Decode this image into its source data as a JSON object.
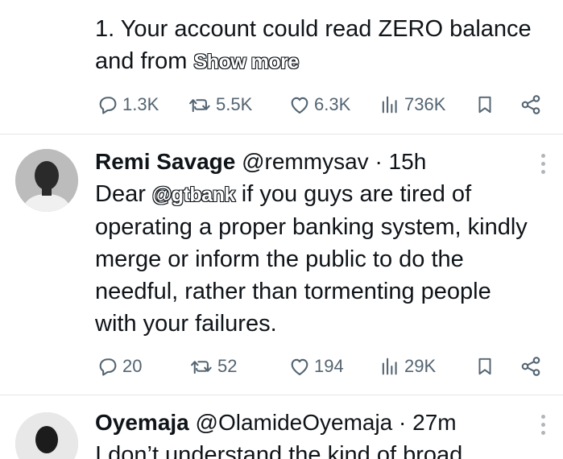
{
  "tweet1": {
    "text_line1": "1. Your account could read ZERO balance",
    "text_line2_prefix": "and from ",
    "show_more": "Show more",
    "replies": "1.3K",
    "retweets": "5.5K",
    "likes": "6.3K",
    "views": "736K"
  },
  "tweet2": {
    "name": "Remi Savage",
    "handle": "@remmysav",
    "separator": "·",
    "time": "15h",
    "text_prefix": "Dear ",
    "mention": "@gtbank",
    "text_rest": " if you guys are tired of operating a proper banking system, kindly merge or inform the public to do the needful, rather than tormenting people with your failures.",
    "replies": "20",
    "retweets": "52",
    "likes": "194",
    "views": "29K"
  },
  "tweet3": {
    "name": "Oyemaja",
    "handle": "@OlamideOyemaja",
    "separator": "·",
    "time": "27m",
    "text_partial": "I don’t understand the kind of broad"
  },
  "icons": {
    "reply": "reply-icon",
    "retweet": "retweet-icon",
    "like": "heart-icon",
    "views": "views-icon",
    "bookmark": "bookmark-icon",
    "share": "share-icon",
    "more": "more-icon"
  },
  "colors": {
    "text": "#0f1419",
    "muted": "#536471",
    "divider": "#e1e6ea"
  }
}
